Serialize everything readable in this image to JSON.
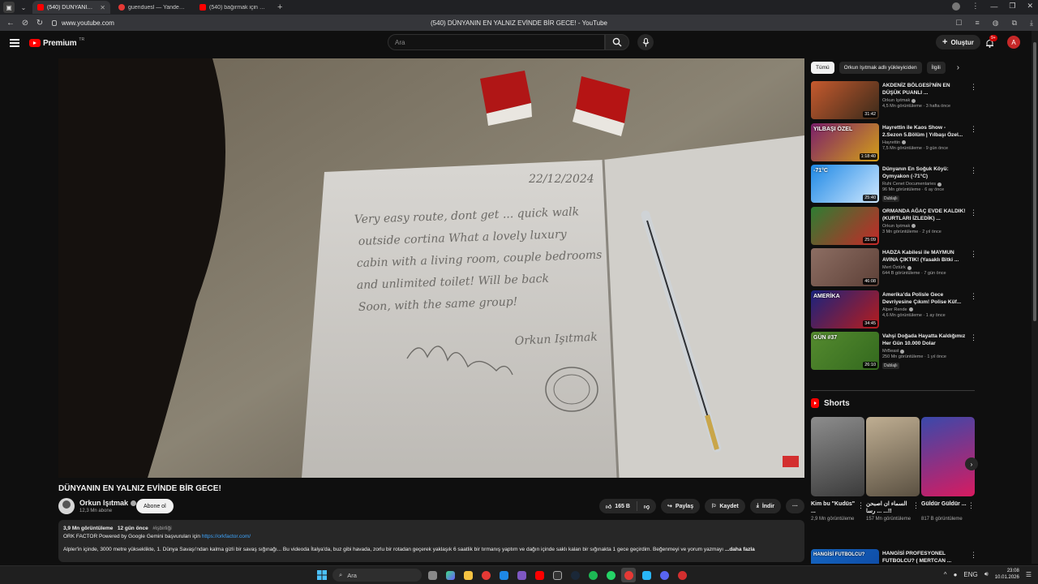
{
  "browser": {
    "tabs": [
      {
        "label": "(540) DÜNYANIN EN YALNIZ",
        "favicon_color": "#ff0000",
        "active": true
      },
      {
        "label": "guenduesl — Yandex: 60 b",
        "favicon_color": "#e53935",
        "active": false
      },
      {
        "label": "(540) bağırmak için dükkan",
        "favicon_color": "#ff0000",
        "active": false
      }
    ],
    "url": "www.youtube.com",
    "page_title": "(540) DÜNYANIN EN YALNIZ EVİNDE BİR GECE! - YouTube"
  },
  "header": {
    "logo_text": "Premium",
    "logo_sup": "TR",
    "search_placeholder": "Ara",
    "create_label": "Oluştur",
    "notif_count": "9+",
    "avatar_letter": "A"
  },
  "video": {
    "title": "DÜNYANIN EN YALNIZ EVİNDE BİR GECE!",
    "channel": "Orkun Işıtmak",
    "subs": "12,3 Mn abone",
    "subscribe_label": "Abone ol",
    "likes": "165 B",
    "share_label": "Paylaş",
    "save_label": "Kaydet",
    "download_label": "İndir",
    "more_label": "···",
    "views": "3,9 Mn görüntüleme",
    "age": "12 gün önce",
    "hashtag": "#işbirliği",
    "desc_line1": "ORK FACTOR Powered by Google Gemini başvuruları için",
    "desc_link": "https://orkfactor.com/",
    "desc_line2": "Alpler'in içinde, 3000 metre yükseklikte, 1. Dünya Savaşı'ndan kalma gizli bir savaş sığınağı... Bu videoda İtalya'da, buz gibi havada, zorlu bir rotadan geçerek yaklaşık 6 saatlik bir tırmanış yaptım ve dağın içinde saklı kalan bir sığınakta 1 gece geçirdim. Beğenmeyi ve yorum yazmayı",
    "more_text": "...daha fazla",
    "notebook_text": [
      "Very easy route, dont get ... quick walk",
      "outside cortina What a lovely luxury",
      "cabin with a living room, couple bedrooms",
      "and unlimited toilet! Will be back",
      "Soon, with the same group!"
    ],
    "notebook_date": "22/12/2024",
    "notebook_signature": "Orkun Işıtmak"
  },
  "sidebar": {
    "chips": [
      "Tümü",
      "Orkun Işıtmak adlı yükleyiciden",
      "İlgili"
    ],
    "recs": [
      {
        "title": "AKDENİZ BÖLGESİ'NİN EN DÜŞÜK PUANLI ...",
        "channel": "Orkun Işıtmak",
        "views": "4,5 Mn görüntüleme · 3 hafta önce",
        "duration": "31:42",
        "overlay": "",
        "dubbed": "",
        "c1": "#c65a2e",
        "c2": "#3a2a1a"
      },
      {
        "title": "Hayrettin ile Kaos Show - 2.Sezon 5.Bölüm | Yılbaşı Özel...",
        "channel": "Hayrettin",
        "views": "7,5 Mn görüntüleme · 9 gün önce",
        "duration": "1:18:40",
        "overlay": "YILBAŞI ÖZEL",
        "dubbed": "",
        "c1": "#7b1f6a",
        "c2": "#d4a017"
      },
      {
        "title": "Dünyanın En Soğuk Köyü: Oymyakon (-71°C)",
        "channel": "Ruhi Cenet Documentaries",
        "views": "96 Mn görüntüleme · 6 ay önce",
        "duration": "25:40",
        "overlay": "-71°C",
        "dubbed": "Dublajlı",
        "c1": "#1e88e5",
        "c2": "#cfe8ff"
      },
      {
        "title": "ORMANDA AĞAÇ EVDE KALDIK! (KURTLARI İZLEDİK) ...",
        "channel": "Orkun Işıtmak",
        "views": "3 Mn görüntüleme · 2 yıl önce",
        "duration": "25:09",
        "overlay": "",
        "dubbed": "",
        "c1": "#2e7d32",
        "c2": "#c62828"
      },
      {
        "title": "HADZA Kabilesi ile MAYMUN AVINA ÇIKTIK! (Yasaklı Bitki ...",
        "channel": "Mert Öztürk",
        "views": "644 B görüntüleme · 7 gün önce",
        "duration": "46:08",
        "overlay": "",
        "dubbed": "",
        "c1": "#8d6e63",
        "c2": "#5d4037"
      },
      {
        "title": "Amerika'da Polisle Gece Devriyesine Çıkım! Polise Küf...",
        "channel": "Alper Rende",
        "views": "4,6 Mn görüntüleme · 1 ay önce",
        "duration": "34:45",
        "overlay": "AMERİKA",
        "dubbed": "",
        "c1": "#1a237e",
        "c2": "#b71c1c"
      },
      {
        "title": "Vahşi Doğada Hayatta Kaldığımız Her Gün 10.000 Dolar",
        "channel": "MrBeast",
        "views": "250 Mn görüntüleme · 1 yıl önce",
        "duration": "26:10",
        "overlay": "GÜN #37",
        "dubbed": "Dublajlı",
        "c1": "#558b2f",
        "c2": "#33691e"
      }
    ],
    "shorts_title": "Shorts",
    "shorts": [
      {
        "title": "Kim bu \"Kudüs\" ...",
        "views": "2,9 Mn görüntüleme",
        "c1": "#8d8d8d",
        "c2": "#3b3b3b"
      },
      {
        "title": "السماء ان اصبحن ... رسا ...!!",
        "views": "157 Mn görüntüleme",
        "c1": "#bfae92",
        "c2": "#5b5142"
      },
      {
        "title": "Güldür Güldür ...",
        "views": "817 B görüntüleme",
        "c1": "#3949ab",
        "c2": "#d81b60"
      }
    ],
    "last_rec": {
      "title": "HANGİSİ PROFESYONEL FUTBOLCU? ( MERTCAN ..."
    }
  },
  "taskbar": {
    "search": "Ara",
    "time": "23:08",
    "date": "10.01.2026"
  }
}
